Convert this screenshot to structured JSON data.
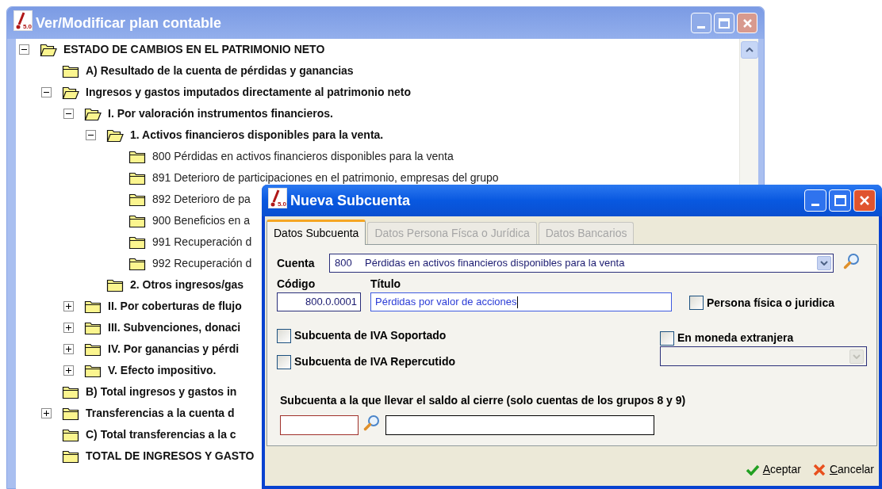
{
  "main_window": {
    "title": "Ver/Modificar plan contable",
    "logo_text": "5.0",
    "tree": [
      {
        "label": "ESTADO DE CAMBIOS EN EL PATRIMONIO NETO",
        "kind": "group",
        "expanded": true,
        "children": [
          {
            "label": "A) Resultado de la cuenta de pérdidas y ganancias",
            "kind": "group"
          },
          {
            "label": "Ingresos y gastos imputados directamente al patrimonio neto",
            "kind": "group",
            "expanded": true,
            "children": [
              {
                "label": "I. Por valoración instrumentos financieros.",
                "kind": "group",
                "expanded": true,
                "children": [
                  {
                    "label": "1. Activos financieros disponibles para la venta.",
                    "kind": "group",
                    "expanded": true,
                    "children": [
                      {
                        "label": "800 Pérdidas en activos financieros disponibles para la venta",
                        "kind": "account"
                      },
                      {
                        "label": "891 Deterioro de participaciones en el patrimonio, empresas del grupo",
                        "kind": "account"
                      },
                      {
                        "label": "892 Deterioro de pa",
                        "kind": "account"
                      },
                      {
                        "label": "900 Beneficios en a",
                        "kind": "account"
                      },
                      {
                        "label": "991 Recuperación d",
                        "kind": "account"
                      },
                      {
                        "label": "992 Recuperación d",
                        "kind": "account"
                      }
                    ]
                  },
                  {
                    "label": "2. Otros ingresos/gas",
                    "kind": "group"
                  }
                ]
              },
              {
                "label": "II. Por coberturas de flujo",
                "kind": "group",
                "expanded": false
              },
              {
                "label": "III. Subvenciones, donaci",
                "kind": "group",
                "expanded": false
              },
              {
                "label": "IV. Por ganancias y pérdi",
                "kind": "group",
                "expanded": false
              },
              {
                "label": "V. Efecto impositivo.",
                "kind": "group",
                "expanded": false
              }
            ]
          },
          {
            "label": "B) Total ingresos y gastos in",
            "kind": "group"
          },
          {
            "label": "Transferencias a la cuenta d",
            "kind": "group",
            "expanded": false
          },
          {
            "label": "C) Total transferencias a la c",
            "kind": "group"
          },
          {
            "label": "TOTAL DE INGRESOS Y GASTO",
            "kind": "group"
          }
        ]
      }
    ]
  },
  "dialog": {
    "title": "Nueva Subcuenta",
    "logo_text": "5.0",
    "tabs": [
      {
        "label": "Datos Subcuenta",
        "selected": true
      },
      {
        "label": "Datos Persona Físca o Jurídica",
        "selected": false
      },
      {
        "label": "Datos Bancarios",
        "selected": false
      }
    ],
    "cuenta": {
      "label": "Cuenta",
      "code": "800",
      "name": "Pérdidas en activos financieros disponibles para la venta"
    },
    "codigo": {
      "label": "Código",
      "value": "800.0.0001"
    },
    "titulo": {
      "label": "Título",
      "value": "Pérdidas por valor de acciones"
    },
    "persona_fisica": {
      "label": "Persona física o juridica",
      "checked": false
    },
    "iva_soportado": {
      "label": "Subcuenta de IVA Soportado",
      "checked": false
    },
    "iva_repercutido": {
      "label": "Subcuenta de IVA Repercutido",
      "checked": false
    },
    "moneda_extranjera": {
      "label": "En moneda extranjera",
      "checked": false
    },
    "cierre": {
      "label": "Subcuenta a la que llevar el saldo al cierre (solo cuentas de los grupos 8 y 9)"
    },
    "buttons": [
      {
        "label": "Aceptar",
        "kind": "accept"
      },
      {
        "label": "Cancelar",
        "kind": "cancel"
      }
    ]
  }
}
